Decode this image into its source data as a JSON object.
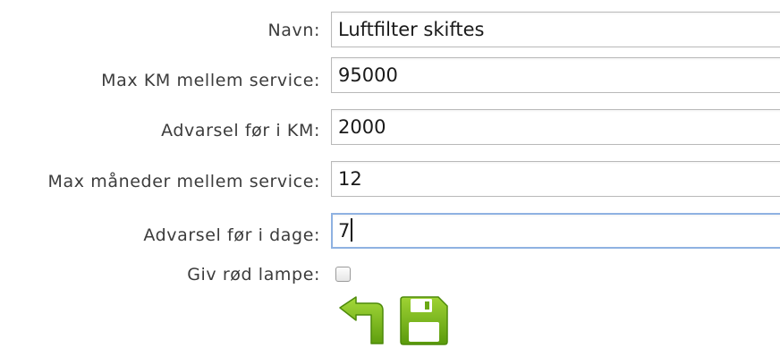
{
  "form": {
    "fields": [
      {
        "label": "Navn:",
        "value": "Luftfilter skiftes"
      },
      {
        "label": "Max KM mellem service:",
        "value": "95000"
      },
      {
        "label": "Advarsel før i KM:",
        "value": "2000"
      },
      {
        "label": "Max måneder mellem service:",
        "value": "12"
      },
      {
        "label": "Advarsel før i dage:",
        "value": "7"
      }
    ],
    "checkbox": {
      "label": "Giv rød lampe:",
      "checked": false
    },
    "actions": {
      "back_icon": "return-arrow-icon",
      "save_icon": "floppy-disk-icon",
      "icon_color": "#7dbb1a"
    }
  }
}
